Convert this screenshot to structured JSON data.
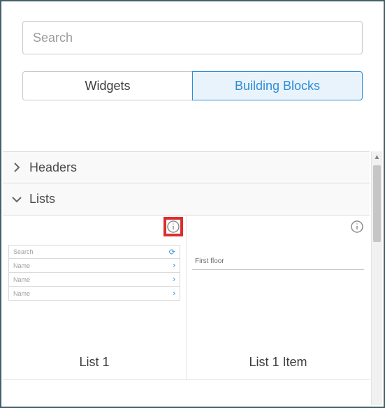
{
  "search": {
    "placeholder": "Search"
  },
  "tabs": {
    "widgets": "Widgets",
    "building_blocks": "Building Blocks"
  },
  "sections": {
    "headers": "Headers",
    "lists": "Lists"
  },
  "cards": {
    "list1": {
      "title": "List 1",
      "preview": {
        "search_placeholder": "Search",
        "row": "Name"
      }
    },
    "list1_item": {
      "title": "List 1 Item",
      "preview": {
        "item_label": "First floor"
      }
    }
  }
}
